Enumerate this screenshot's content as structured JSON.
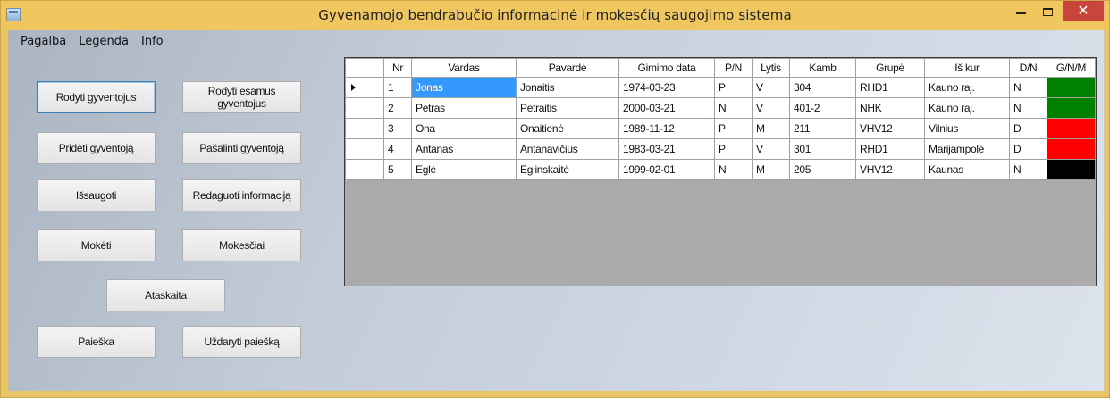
{
  "window": {
    "title": "Gyvenamojo bendrabučio informacinė ir mokesčių saugojimo sistema",
    "close_glyph": "✕",
    "titlebar_color": "#f0c65e",
    "close_color": "#c7453a"
  },
  "menu": [
    "Pagalba",
    "Legenda",
    "Info"
  ],
  "buttons": {
    "show_residents": "Rodyti gyventojus",
    "show_current": "Rodyti esamus gyventojus",
    "add_resident": "Pridėti gyventoją",
    "remove_resident": "Pašalinti gyventoją",
    "save": "Išsaugoti",
    "edit_info": "Redaguoti informaciją",
    "pay": "Mokėti",
    "fees": "Mokesčiai",
    "report": "Ataskaita",
    "search": "Paieška",
    "close_search": "Uždaryti paiešką"
  },
  "table": {
    "columns": [
      "Nr",
      "Vardas",
      "Pavardė",
      "Gimimo data",
      "P/N",
      "Lytis",
      "Kamb",
      "Grupė",
      "Iš kur",
      "D/N",
      "G/N/M"
    ],
    "rows": [
      {
        "nr": "1",
        "vardas": "Jonas",
        "pavarde": "Jonaitis",
        "gimimo_data": "1974-03-23",
        "pn": "P",
        "lytis": "V",
        "kamb": "304",
        "grupe": "RHD1",
        "is_kur": "Kauno raj.",
        "dn": "N",
        "status_color": "#008000"
      },
      {
        "nr": "2",
        "vardas": "Petras",
        "pavarde": "Petraitis",
        "gimimo_data": "2000-03-21",
        "pn": "N",
        "lytis": "V",
        "kamb": "401-2",
        "grupe": "NHK",
        "is_kur": "Kauno raj.",
        "dn": "N",
        "status_color": "#008000"
      },
      {
        "nr": "3",
        "vardas": "Ona",
        "pavarde": "Onaitienė",
        "gimimo_data": "1989-11-12",
        "pn": "P",
        "lytis": "M",
        "kamb": "211",
        "grupe": "VHV12",
        "is_kur": "Vilnius",
        "dn": "D",
        "status_color": "#ff0000"
      },
      {
        "nr": "4",
        "vardas": "Antanas",
        "pavarde": "Antanavičius",
        "gimimo_data": "1983-03-21",
        "pn": "P",
        "lytis": "V",
        "kamb": "301",
        "grupe": "RHD1",
        "is_kur": "Marijampolė",
        "dn": "D",
        "status_color": "#ff0000"
      },
      {
        "nr": "5",
        "vardas": "Eglė",
        "pavarde": "Eglinskaitė",
        "gimimo_data": "1999-02-01",
        "pn": "N",
        "lytis": "M",
        "kamb": "205",
        "grupe": "VHV12",
        "is_kur": "Kaunas",
        "dn": "N",
        "status_color": "#000000"
      }
    ],
    "current_row": 0,
    "selected_cell_color": "#3399ff"
  }
}
